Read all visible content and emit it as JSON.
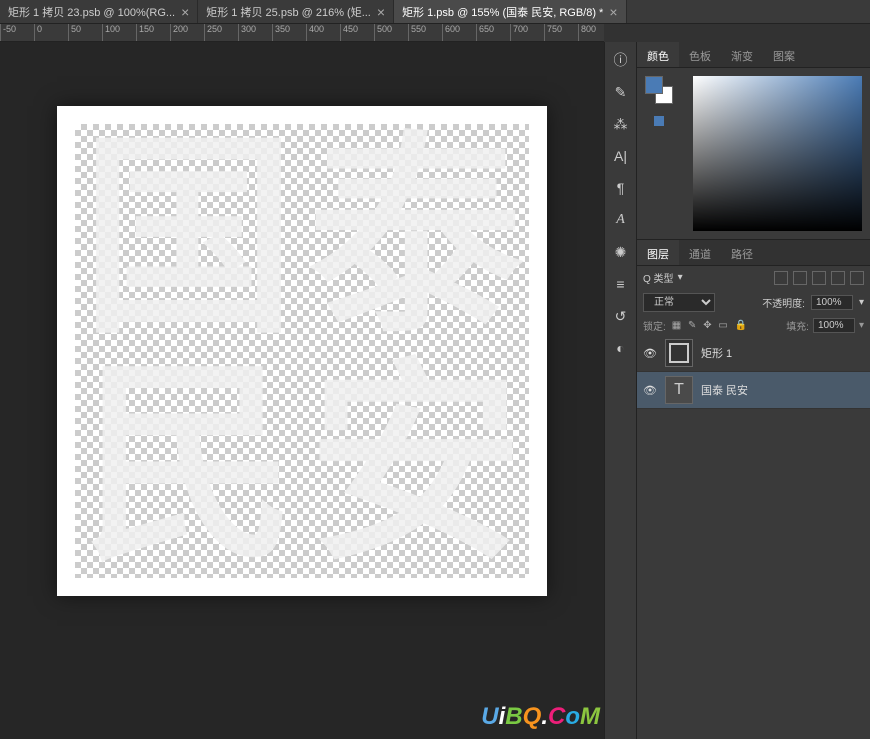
{
  "tabs": [
    {
      "label": "矩形 1 拷贝 23.psb @ 100%(RG...",
      "active": false
    },
    {
      "label": "矩形 1 拷贝 25.psb @ 216% (矩...",
      "active": false
    },
    {
      "label": "矩形 1.psb @ 155% (国泰 民安, RGB/8) *",
      "active": true
    }
  ],
  "ruler": [
    "-50",
    "0",
    "50",
    "100",
    "150",
    "200",
    "250",
    "300",
    "350",
    "400",
    "450",
    "500",
    "550",
    "600",
    "650",
    "700",
    "750",
    "800"
  ],
  "canvas_chars": [
    "国",
    "泰",
    "民",
    "安"
  ],
  "toolbar_icons": [
    "info",
    "brush",
    "wand",
    "type",
    "paragraph",
    "typography",
    "starburst",
    "timeline",
    "history",
    "adjust"
  ],
  "color_panel": {
    "tabs": [
      "颜色",
      "色板",
      "渐变",
      "图案"
    ],
    "active_tab": "颜色"
  },
  "layers_panel": {
    "tabs": [
      "图层",
      "通道",
      "路径"
    ],
    "active_tab": "图层",
    "search_placeholder": "Q 类型",
    "blend_mode": "正常",
    "opacity_label": "不透明度:",
    "opacity_value": "100%",
    "lock_label": "锁定:",
    "fill_label": "填充:",
    "fill_value": "100%",
    "layers": [
      {
        "name": "矩形 1",
        "type": "shape",
        "visible": true,
        "selected": false
      },
      {
        "name": "国泰 民安",
        "type": "text",
        "visible": true,
        "selected": true
      }
    ]
  },
  "watermark": "UiBQ.CoM"
}
